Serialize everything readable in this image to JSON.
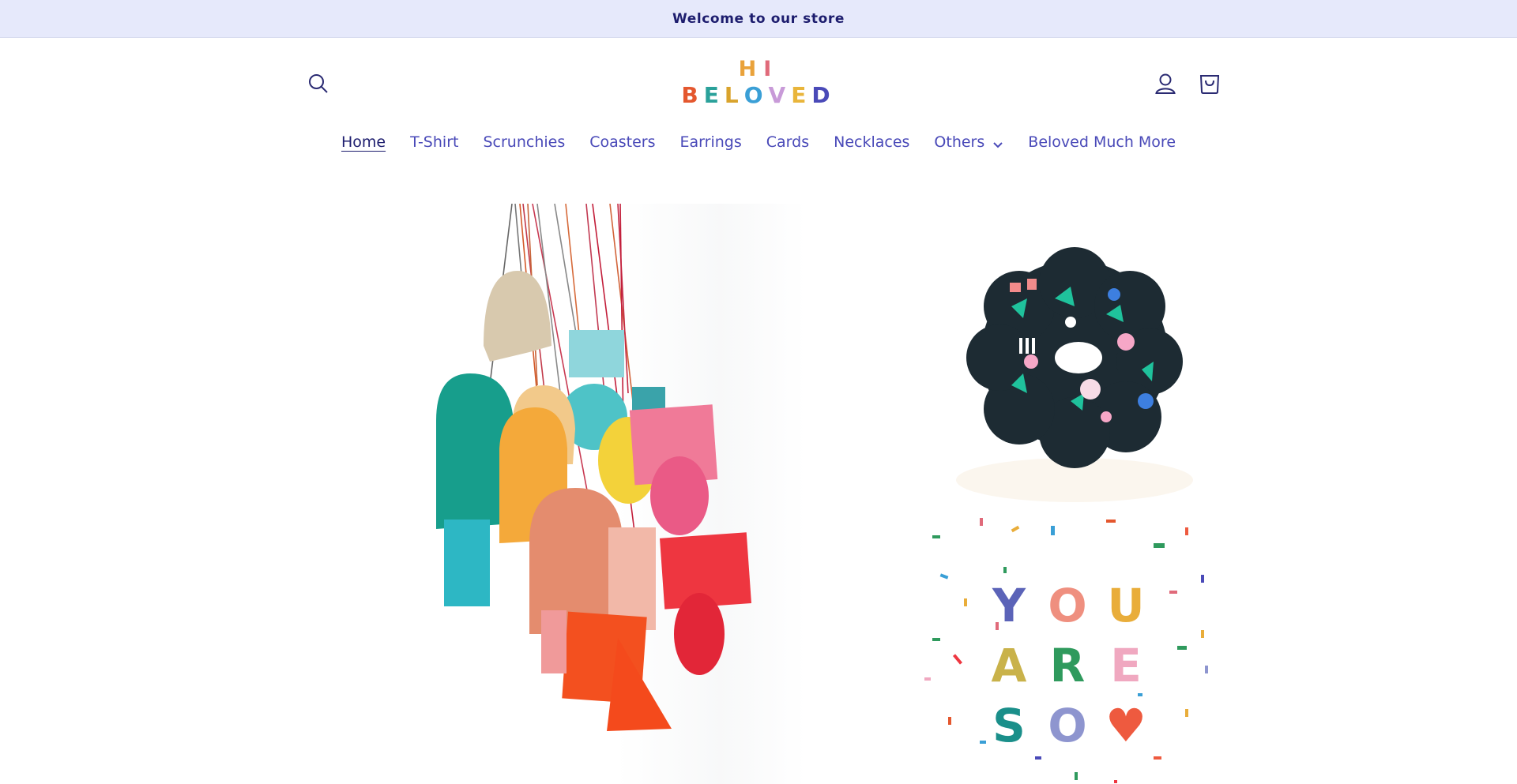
{
  "announcement": {
    "text": "Welcome to our store"
  },
  "logo": {
    "line1": [
      {
        "ch": "H",
        "color": "#e9a23b"
      },
      {
        "ch": "I",
        "color": "#e06a7a"
      }
    ],
    "line2": [
      {
        "ch": "B",
        "color": "#e4572e"
      },
      {
        "ch": "E",
        "color": "#2aa19a"
      },
      {
        "ch": "L",
        "color": "#d9a32c"
      },
      {
        "ch": "O",
        "color": "#3a9fd6"
      },
      {
        "ch": "V",
        "color": "#c89ad8"
      },
      {
        "ch": "E",
        "color": "#e9b53b"
      },
      {
        "ch": "D",
        "color": "#4a4ab8"
      }
    ]
  },
  "header": {
    "search_icon": "search-icon",
    "account_icon": "account-icon",
    "cart_icon": "cart-icon"
  },
  "nav": {
    "items": [
      {
        "label": "Home",
        "active": true
      },
      {
        "label": "T-Shirt"
      },
      {
        "label": "Scrunchies"
      },
      {
        "label": "Coasters"
      },
      {
        "label": "Earrings"
      },
      {
        "label": "Cards"
      },
      {
        "label": "Necklaces"
      },
      {
        "label": "Others",
        "dropdown": true
      },
      {
        "label": "Beloved Much More"
      }
    ]
  },
  "card": {
    "letters": [
      {
        "ch": "Y",
        "color": "#5b63b8"
      },
      {
        "ch": "O",
        "color": "#ef8f7f"
      },
      {
        "ch": "U",
        "color": "#e9ad3a"
      },
      {
        "ch": "A",
        "color": "#c9b24a"
      },
      {
        "ch": "R",
        "color": "#2f9a5d"
      },
      {
        "ch": "E",
        "color": "#f0a8c0"
      },
      {
        "ch": "S",
        "color": "#1a8f8a"
      },
      {
        "ch": "O",
        "color": "#8e95cf"
      },
      {
        "ch": "♥",
        "color": "#ee5a3f"
      }
    ]
  },
  "colors": {
    "announcement_bg": "#e6e9fb",
    "nav_text": "#4949b8",
    "nav_active": "#1d1d6e"
  }
}
